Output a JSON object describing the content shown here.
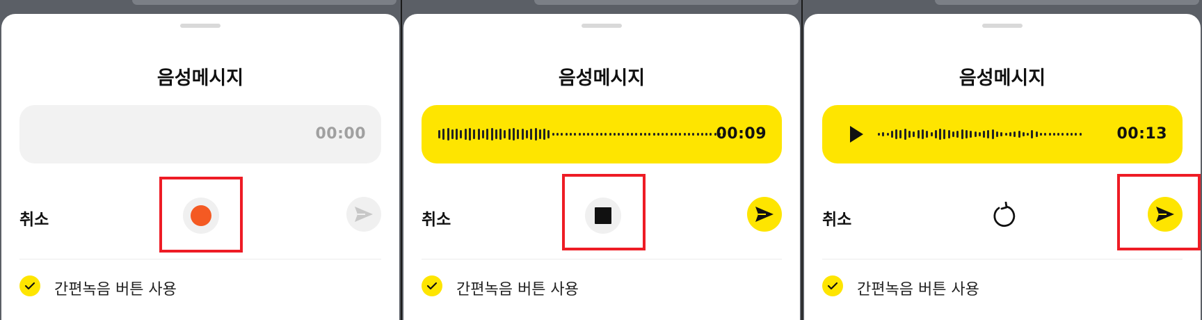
{
  "colors": {
    "kakao_yellow": "#fee500",
    "record_orange": "#f45a23",
    "highlight_red": "#ee1c25",
    "idle_grey": "#f2f2f2"
  },
  "panels": [
    {
      "state": "idle",
      "title": "음성메시지",
      "time": "00:00",
      "cancel_label": "취소",
      "center_control": "record-icon",
      "send_enabled": false,
      "option_label": "간편녹음 버튼 사용",
      "option_checked": true
    },
    {
      "state": "recording",
      "title": "음성메시지",
      "time": "00:09",
      "cancel_label": "취소",
      "center_control": "stop-icon",
      "send_enabled": true,
      "option_label": "간편녹음 버튼 사용",
      "option_checked": true
    },
    {
      "state": "recorded",
      "title": "음성메시지",
      "time": "00:13",
      "cancel_label": "취소",
      "center_control": "retry-icon",
      "send_enabled": true,
      "option_label": "간편녹음 버튼 사용",
      "option_checked": true
    }
  ]
}
